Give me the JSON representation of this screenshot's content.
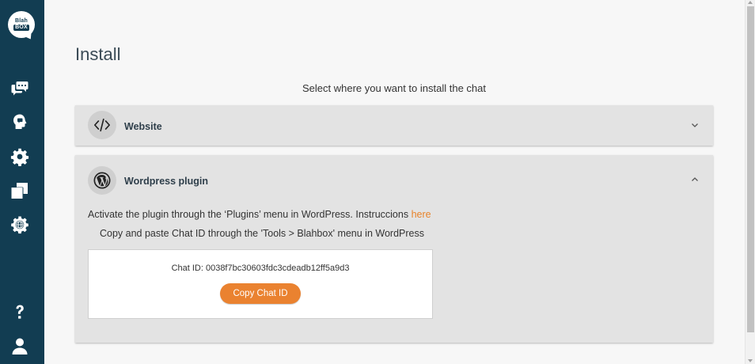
{
  "sidebar": {
    "logo_line1": "Blah",
    "logo_line2": "BOX",
    "items": [
      {
        "icon": "chat-bubbles-icon"
      },
      {
        "icon": "head-profile-icon"
      },
      {
        "icon": "gear-icon"
      },
      {
        "icon": "window-restore-icon"
      },
      {
        "icon": "globe-gear-icon"
      }
    ],
    "bottom": [
      {
        "icon": "help-question-icon"
      },
      {
        "icon": "user-icon"
      }
    ]
  },
  "page": {
    "title": "Install",
    "subtitle": "Select where you want to install the chat"
  },
  "panels": {
    "website": {
      "icon": "code-brackets-icon",
      "title": "Website",
      "expanded": false
    },
    "wordpress": {
      "icon": "wordpress-icon",
      "title": "Wordpress plugin",
      "expanded": true,
      "instruction1": "Activate the plugin through the ‘Plugins’ menu in WordPress. Instruccions",
      "instruction1_link": "here",
      "instruction2": "Copy and paste Chat ID through the 'Tools > Blahbox' menu in WordPress",
      "chat_id_text": "Chat ID: 0038f7bc30603fdc3cdeadb12ff5a9d3",
      "copy_button": "Copy Chat ID"
    }
  },
  "colors": {
    "sidebar": "#123d52",
    "accent": "#ea8230",
    "panel": "#e3e3e3"
  }
}
